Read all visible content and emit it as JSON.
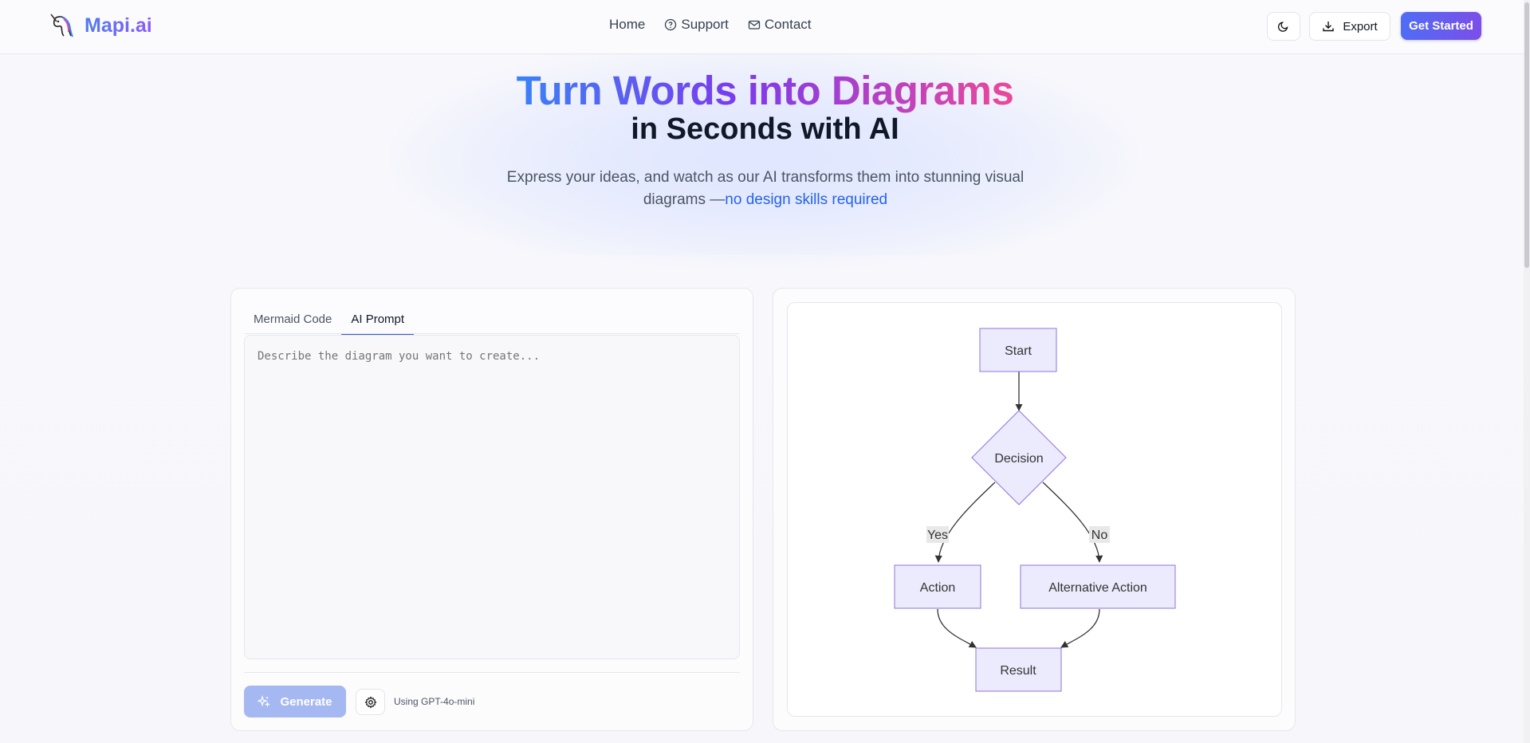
{
  "header": {
    "brand": "Mapi.ai",
    "nav": [
      {
        "label": "Home",
        "icon": "none"
      },
      {
        "label": "Support",
        "icon": "help-circle-icon"
      },
      {
        "label": "Contact",
        "icon": "mail-icon"
      }
    ],
    "export_label": "Export",
    "cta_label": "Get Started"
  },
  "hero": {
    "title": "Turn Words into Diagrams",
    "subtitle": "in Seconds with AI",
    "desc_main": "Express your ideas, and watch as our AI transforms them into stunning visual diagrams —",
    "desc_highlight": "no design skills required"
  },
  "editor": {
    "tabs": [
      "Mermaid Code",
      "AI Prompt"
    ],
    "active_tab": "AI Prompt",
    "prompt_placeholder": "Describe the diagram you want to create...",
    "generate_label": "Generate",
    "model_text": "Using GPT-4o-mini"
  },
  "diagram": {
    "nodes": {
      "start": "Start",
      "decision": "Decision",
      "action": "Action",
      "alt_action": "Alternative Action",
      "result": "Result"
    },
    "edge_labels": {
      "yes": "Yes",
      "no": "No"
    },
    "node_fill": "#ecebfd",
    "node_stroke": "#9370db"
  },
  "colors": {
    "accent": "#4f6df5",
    "highlight": "#2563eb"
  }
}
